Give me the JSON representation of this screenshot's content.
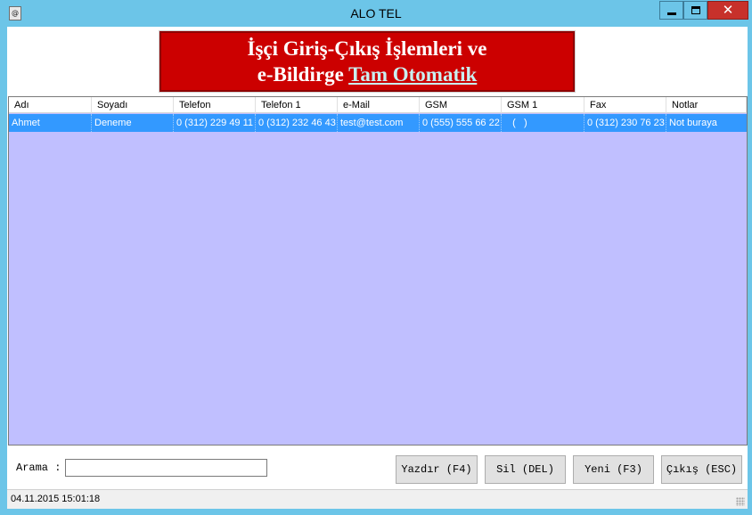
{
  "window": {
    "title": "ALO TEL"
  },
  "titlebar": {
    "close_glyph": "✕",
    "icons": [
      "app-icon",
      "minimize-icon",
      "maximize-icon",
      "close-icon"
    ]
  },
  "banner": {
    "line1": "İşçi Giriş-Çıkış İşlemleri ve",
    "line2_prefix": "e-Bildirge ",
    "line2_link": "Tam Otomatik",
    "background_color": "#cc0000",
    "link_color": "#c9eff0"
  },
  "grid": {
    "columns": [
      "Adı",
      "Soyadı",
      "Telefon",
      "Telefon 1",
      "e-Mail",
      "GSM",
      "GSM 1",
      "Fax",
      "Notlar"
    ],
    "rows": [
      [
        "Ahmet",
        "Deneme",
        "0 (312) 229 49 11",
        "0 (312) 232 46 43",
        "test@test.com",
        "0 (555) 555 66 22",
        "   (   )",
        "0 (312) 230 76 23",
        "Not buraya"
      ]
    ],
    "selected_row": 0,
    "background_color": "#c0bfff",
    "selection_color": "#3399ff"
  },
  "search": {
    "label": "Arama :",
    "value": ""
  },
  "buttons": {
    "print": "Yazdır (F4)",
    "delete": "Sil (DEL)",
    "new": "Yeni (F3)",
    "exit": "Çıkış (ESC)"
  },
  "status": {
    "datetime": "04.11.2015 15:01:18"
  },
  "colors": {
    "title_bar": "#6cc5e8",
    "close_button": "#c7312b"
  }
}
